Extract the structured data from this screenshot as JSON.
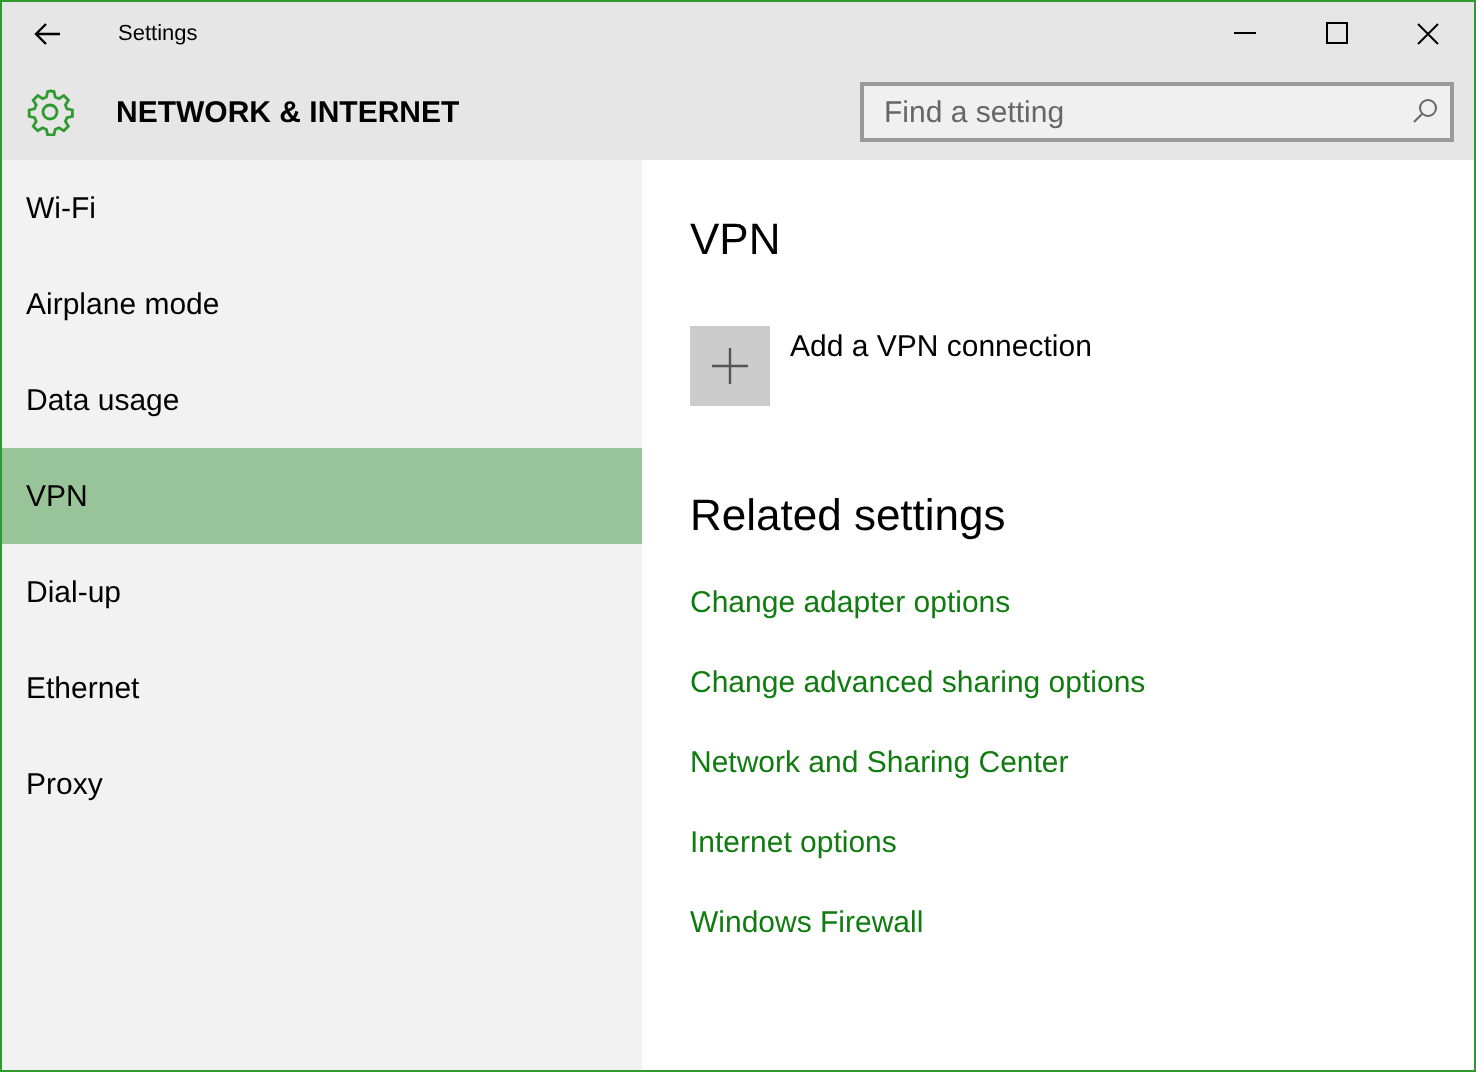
{
  "window": {
    "title": "Settings"
  },
  "header": {
    "title": "NETWORK & INTERNET",
    "search": {
      "placeholder": "Find a setting"
    }
  },
  "sidebar": {
    "items": [
      {
        "label": "Wi-Fi",
        "selected": false
      },
      {
        "label": "Airplane mode",
        "selected": false
      },
      {
        "label": "Data usage",
        "selected": false
      },
      {
        "label": "VPN",
        "selected": true
      },
      {
        "label": "Dial-up",
        "selected": false
      },
      {
        "label": "Ethernet",
        "selected": false
      },
      {
        "label": "Proxy",
        "selected": false
      }
    ]
  },
  "content": {
    "title": "VPN",
    "add_button": {
      "label": "Add a VPN connection"
    },
    "related_title": "Related settings",
    "links": [
      "Change adapter options",
      "Change advanced sharing options",
      "Network and Sharing Center",
      "Internet options",
      "Windows Firewall"
    ]
  }
}
